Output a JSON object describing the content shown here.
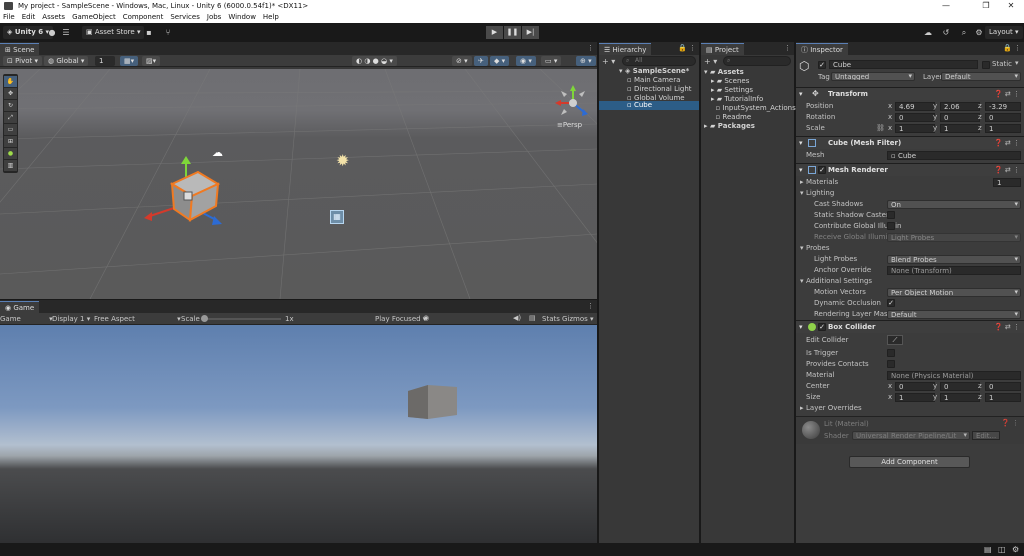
{
  "window": {
    "title": "My project - SampleScene - Windows, Mac, Linux - Unity 6 (6000.0.54f1)* <DX11>",
    "controls": [
      "—",
      "❐",
      "✕"
    ]
  },
  "menu": [
    "File",
    "Edit",
    "Assets",
    "GameObject",
    "Component",
    "Services",
    "Jobs",
    "Window",
    "Help"
  ],
  "toolbar": {
    "unity_label": "Unity 6",
    "asset_store": "Asset Store",
    "layout": "Layout"
  },
  "scene": {
    "tab": "Scene",
    "pivot": "Pivot",
    "global": "Global",
    "grid_snap": "1",
    "persp": "≡Persp",
    "axes": {
      "x": "x",
      "y": "y",
      "z": "z"
    }
  },
  "game": {
    "tab": "Game",
    "mode": "Game",
    "display": "Display 1",
    "aspect": "Free Aspect",
    "scale_label": "Scale",
    "scale_value": "1x",
    "play_focused": "Play Focused",
    "stats": "Stats",
    "gizmos": "Gizmos"
  },
  "hierarchy": {
    "tab": "Hierarchy",
    "search_placeholder": "All",
    "scene": "SampleScene*",
    "items": [
      "Main Camera",
      "Directional Light",
      "Global Volume",
      "Cube"
    ],
    "selected": "Cube"
  },
  "project": {
    "tab": "Project",
    "root": "Assets",
    "items": [
      "Scenes",
      "Settings",
      "TutorialInfo",
      "InputSystem_Actions",
      "Readme"
    ],
    "packages": "Packages"
  },
  "inspector": {
    "tab": "Inspector",
    "object_name": "Cube",
    "static_label": "Static",
    "tag_label": "Tag",
    "tag_value": "Untagged",
    "layer_label": "Layer",
    "layer_value": "Default",
    "transform": {
      "title": "Transform",
      "position_label": "Position",
      "rotation_label": "Rotation",
      "scale_label": "Scale",
      "position": {
        "x": "4.69",
        "y": "2.06",
        "z": "-3.29"
      },
      "rotation": {
        "x": "0",
        "y": "0",
        "z": "0"
      },
      "scale": {
        "x": "1",
        "y": "1",
        "z": "1"
      }
    },
    "mesh_filter": {
      "title": "Cube (Mesh Filter)",
      "mesh_label": "Mesh",
      "mesh_value": "Cube"
    },
    "mesh_renderer": {
      "title": "Mesh Renderer",
      "materials_label": "Materials",
      "materials_count": "1",
      "lighting_label": "Lighting",
      "cast_shadows_label": "Cast Shadows",
      "cast_shadows_value": "On",
      "static_shadow_label": "Static Shadow Caster",
      "contribute_gi_label": "Contribute Global Illumin",
      "receive_gi_label": "Receive Global Illuminat",
      "receive_gi_value": "Light Probes",
      "probes_label": "Probes",
      "light_probes_label": "Light Probes",
      "light_probes_value": "Blend Probes",
      "anchor_override_label": "Anchor Override",
      "anchor_override_value": "None (Transform)",
      "additional_label": "Additional Settings",
      "motion_vectors_label": "Motion Vectors",
      "motion_vectors_value": "Per Object Motion",
      "dynamic_occlusion_label": "Dynamic Occlusion",
      "rendering_layer_label": "Rendering Layer Mask",
      "rendering_layer_value": "Default"
    },
    "box_collider": {
      "title": "Box Collider",
      "edit_collider_label": "Edit Collider",
      "is_trigger_label": "Is Trigger",
      "provides_contacts_label": "Provides Contacts",
      "material_label": "Material",
      "material_value": "None (Physics Material)",
      "center_label": "Center",
      "size_label": "Size",
      "center": {
        "x": "0",
        "y": "0",
        "z": "0"
      },
      "size": {
        "x": "1",
        "y": "1",
        "z": "1"
      },
      "layer_overrides_label": "Layer Overrides"
    },
    "material": {
      "name": "Lit (Material)",
      "shader_label": "Shader",
      "shader_value": "Universal Render Pipeline/Lit",
      "edit_label": "Edit..."
    },
    "add_component": "Add Component"
  },
  "colors": {
    "selection": "#2c5d87",
    "panel": "#383838",
    "accent_tab": "#5a7fb5"
  }
}
